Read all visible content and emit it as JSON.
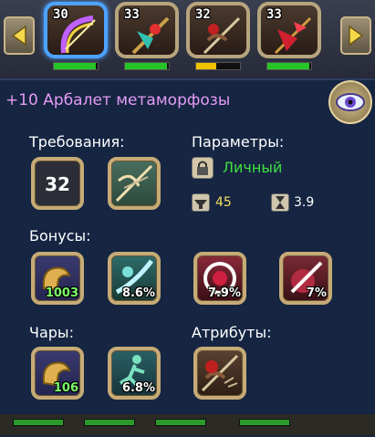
{
  "carousel": {
    "slots": [
      {
        "level": "30",
        "bar_fill": 0.95,
        "bar_color": "#27c427",
        "selected": true,
        "icon": "rainbow-bow-icon"
      },
      {
        "level": "33",
        "bar_fill": 0.95,
        "bar_color": "#27c427",
        "selected": false,
        "icon": "green-crossbow-icon"
      },
      {
        "level": "32",
        "bar_fill": 0.45,
        "bar_color": "#f0c200",
        "selected": false,
        "icon": "deer-crossbow-icon"
      },
      {
        "level": "33",
        "bar_fill": 0.95,
        "bar_color": "#27c427",
        "selected": false,
        "icon": "red-crossbow-icon"
      }
    ]
  },
  "item": {
    "title": "+10 Арбалет метаморфозы"
  },
  "requirements": {
    "label": "Требования:",
    "level_value": "32",
    "class_icon": "crossbow-class-icon"
  },
  "parameters": {
    "label": "Параметры:",
    "binding": "Личный",
    "attack": "45",
    "speed": "3.9"
  },
  "bonuses": {
    "label": "Бонусы:",
    "items": [
      {
        "value": "1003",
        "icon": "strength-arm-icon",
        "value_color": "#7dff6a"
      },
      {
        "value": "8.6%",
        "icon": "dodge-slash-icon",
        "value_color": "#ffffff"
      },
      {
        "value": "7.9%",
        "icon": "crit-target-icon",
        "value_color": "#ffffff"
      },
      {
        "value": "7%",
        "icon": "pierce-icon",
        "value_color": "#ffffff"
      }
    ]
  },
  "enchants": {
    "label": "Чары:",
    "items": [
      {
        "value": "106",
        "icon": "strength-arm-icon",
        "value_color": "#7dff6a"
      },
      {
        "value": "6.8%",
        "icon": "runner-icon",
        "value_color": "#ffffff"
      }
    ]
  },
  "attributes": {
    "label": "Атрибуты:",
    "icon": "deer-crossbow-icon"
  },
  "colors": {
    "panel_bg": "#152542",
    "title": "#e59bf4",
    "personal": "#3ee03e",
    "number_gold": "#f2e05a"
  }
}
